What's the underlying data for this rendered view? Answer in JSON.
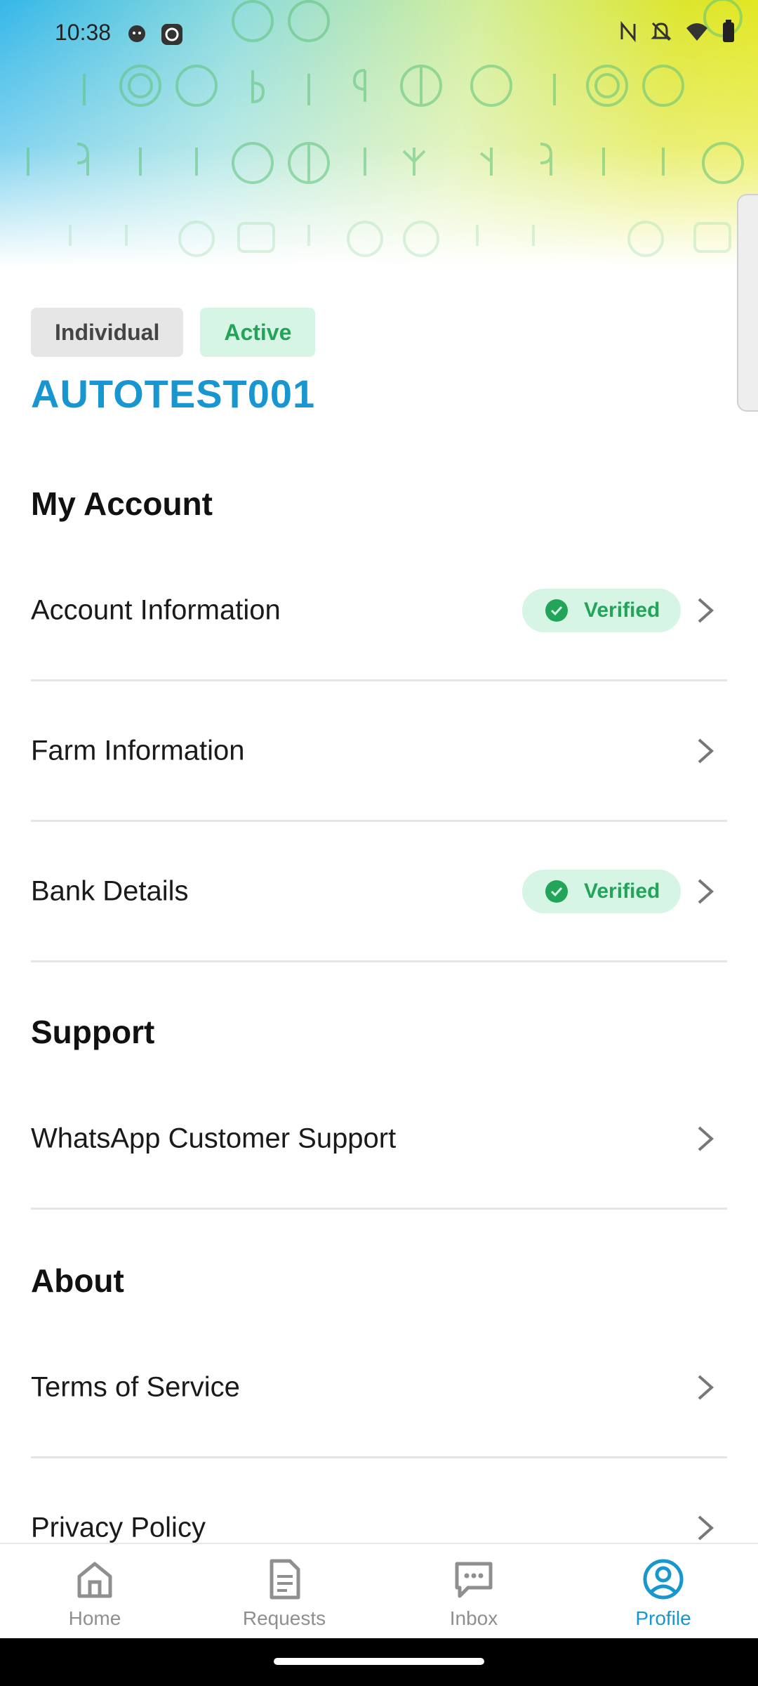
{
  "status_bar": {
    "time": "10:38",
    "icons": [
      "cat-notification-icon",
      "screen-record-icon",
      "nfc-icon",
      "mute-icon",
      "wifi-icon",
      "battery-icon"
    ]
  },
  "profile": {
    "account_type": "Individual",
    "account_status": "Active",
    "username": "AUTOTEST001"
  },
  "sections": {
    "my_account": {
      "title": "My Account",
      "items": [
        {
          "label": "Account Information",
          "badge": "Verified"
        },
        {
          "label": "Farm Information"
        },
        {
          "label": "Bank Details",
          "badge": "Verified"
        }
      ]
    },
    "support": {
      "title": "Support",
      "items": [
        {
          "label": "WhatsApp Customer Support"
        }
      ]
    },
    "about": {
      "title": "About",
      "items": [
        {
          "label": "Terms of Service"
        },
        {
          "label": "Privacy Policy"
        }
      ]
    }
  },
  "bottom_nav": {
    "items": [
      {
        "label": "Home",
        "icon": "home-icon"
      },
      {
        "label": "Requests",
        "icon": "document-icon"
      },
      {
        "label": "Inbox",
        "icon": "chat-icon"
      },
      {
        "label": "Profile",
        "icon": "profile-icon",
        "active": true
      }
    ]
  },
  "colors": {
    "brand": "#1896d0",
    "verified_green": "#23a559",
    "verified_bg": "#d6f5e4",
    "inactive_nav": "#8f8f8f"
  }
}
